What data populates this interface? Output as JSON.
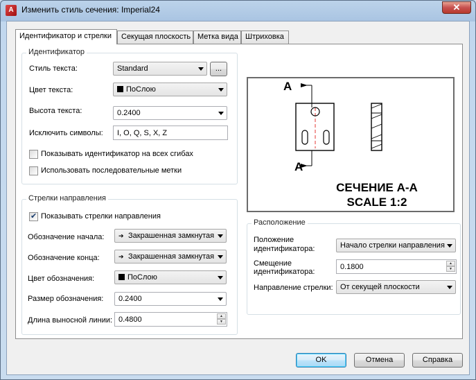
{
  "window": {
    "title": "Изменить стиль сечения: Imperial24",
    "close_glyph": "✕"
  },
  "tabs": [
    {
      "label": "Идентификатор и стрелки"
    },
    {
      "label": "Секущая плоскость"
    },
    {
      "label": "Метка вида"
    },
    {
      "label": "Штриховка"
    }
  ],
  "identifier": {
    "group_title": "Идентификатор",
    "text_style_label": "Стиль текста:",
    "text_style_value": "Standard",
    "browse_label": "...",
    "text_color_label": "Цвет текста:",
    "text_color_value": "ПоСлою",
    "text_height_label": "Высота текста:",
    "text_height_value": "0.2400",
    "exclude_label": "Исключить символы:",
    "exclude_value": "I, O, Q, S, X, Z",
    "show_all_bends_label": "Показывать идентификатор на всех сгибах",
    "consecutive_label": "Использовать последовательные метки"
  },
  "arrows": {
    "group_title": "Стрелки направления",
    "show_arrows_label": "Показывать стрелки направления",
    "start_label": "Обозначение начала:",
    "start_value": "Закрашенная замкнутая",
    "end_label": "Обозначение конца:",
    "end_value": "Закрашенная замкнутая",
    "color_label": "Цвет обозначения:",
    "color_value": "ПоСлою",
    "size_label": "Размер обозначения:",
    "size_value": "0.2400",
    "ext_length_label": "Длина выносной линии:",
    "ext_length_value": "0.4800"
  },
  "preview": {
    "marker_top": "A",
    "marker_bottom": "A",
    "caption_line1": "СЕЧЕНИЕ A-A",
    "caption_line2": "SCALE 1:2"
  },
  "location": {
    "group_title": "Расположение",
    "position_label_1": "Положение",
    "position_label_2": "идентификатора:",
    "position_value": "Начало стрелки направления",
    "offset_label_1": "Смещение",
    "offset_label_2": "идентификатора:",
    "offset_value": "0.1800",
    "direction_label": "Направление стрелки:",
    "direction_value": "От секущей плоскости"
  },
  "footer": {
    "ok": "OK",
    "cancel": "Отмена",
    "help": "Справка"
  }
}
